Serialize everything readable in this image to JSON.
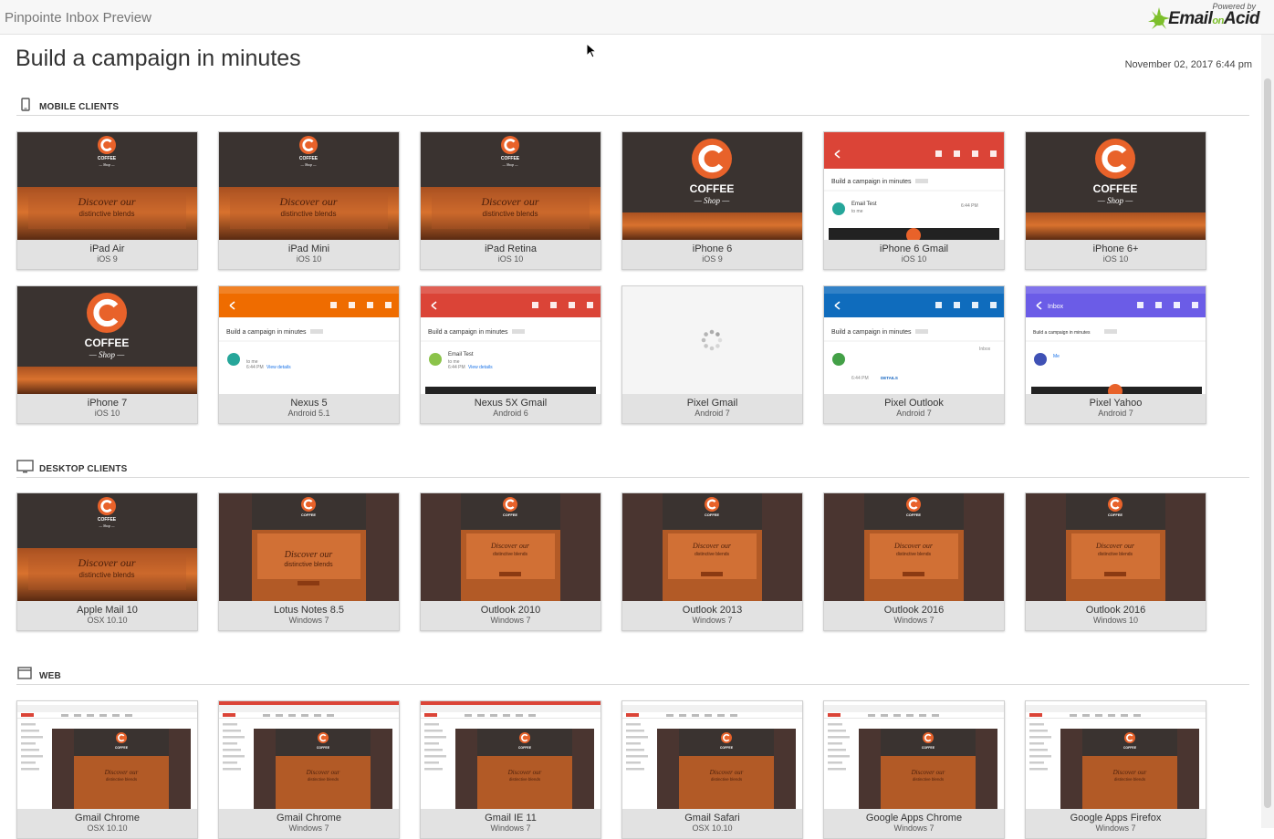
{
  "app": {
    "title": "Pinpointe Inbox Preview",
    "logo_powered": "Powered by",
    "logo_email": "Email",
    "logo_on": "on",
    "logo_acid": "Acid"
  },
  "page": {
    "title": "Build a campaign in minutes",
    "timestamp": "November 02, 2017 6:44 pm"
  },
  "sections": {
    "mobile": {
      "label": "MOBILE CLIENTS",
      "icon": "phone-icon",
      "cards": [
        {
          "name": "iPad Air",
          "os": "iOS 9",
          "kind": "coffee-hero"
        },
        {
          "name": "iPad Mini",
          "os": "iOS 10",
          "kind": "coffee-hero"
        },
        {
          "name": "iPad Retina",
          "os": "iOS 10",
          "kind": "coffee-hero"
        },
        {
          "name": "iPhone 6",
          "os": "iOS 9",
          "kind": "coffee-logo"
        },
        {
          "name": "iPhone 6 Gmail",
          "os": "iOS 10",
          "kind": "gmail-app"
        },
        {
          "name": "iPhone 6+",
          "os": "iOS 10",
          "kind": "coffee-logo"
        },
        {
          "name": "iPhone 7",
          "os": "iOS 10",
          "kind": "coffee-logo"
        },
        {
          "name": "Nexus 5",
          "os": "Android 5.1",
          "kind": "android-orange"
        },
        {
          "name": "Nexus 5X Gmail",
          "os": "Android 6",
          "kind": "android-red"
        },
        {
          "name": "Pixel Gmail",
          "os": "Android 7",
          "kind": "loading"
        },
        {
          "name": "Pixel Outlook",
          "os": "Android 7",
          "kind": "android-blue"
        },
        {
          "name": "Pixel Yahoo",
          "os": "Android 7",
          "kind": "android-purple"
        }
      ]
    },
    "desktop": {
      "label": "DESKTOP CLIENTS",
      "icon": "monitor-icon",
      "cards": [
        {
          "name": "Apple Mail 10",
          "os": "OSX 10.10",
          "kind": "coffee-hero"
        },
        {
          "name": "Lotus Notes 8.5",
          "os": "Windows 7",
          "kind": "desktop-wide"
        },
        {
          "name": "Outlook 2010",
          "os": "Windows 7",
          "kind": "desktop-narrow"
        },
        {
          "name": "Outlook 2013",
          "os": "Windows 7",
          "kind": "desktop-narrow"
        },
        {
          "name": "Outlook 2016",
          "os": "Windows 7",
          "kind": "desktop-narrow"
        },
        {
          "name": "Outlook 2016",
          "os": "Windows 10",
          "kind": "desktop-narrow"
        }
      ]
    },
    "web": {
      "label": "WEB",
      "icon": "browser-window-icon",
      "cards": [
        {
          "name": "Gmail Chrome",
          "os": "OSX 10.10",
          "kind": "web"
        },
        {
          "name": "Gmail Chrome",
          "os": "Windows 7",
          "kind": "web-red"
        },
        {
          "name": "Gmail IE 11",
          "os": "Windows 7",
          "kind": "web-red"
        },
        {
          "name": "Gmail Safari",
          "os": "OSX 10.10",
          "kind": "web"
        },
        {
          "name": "Google Apps Chrome",
          "os": "Windows 7",
          "kind": "web"
        },
        {
          "name": "Google Apps Firefox",
          "os": "Windows 7",
          "kind": "web"
        }
      ]
    }
  },
  "thumb_text": {
    "coffee": "COFFEE",
    "shop": "— Shop —",
    "discover": "Discover our",
    "blends": "distinctive blends",
    "subject": "Build a campaign in minutes",
    "sender": "Email Test",
    "to_me": "to me",
    "time": "6:44 PM",
    "inbox": "Inbox",
    "me": "Me",
    "details": "DETAILS",
    "view_details": "View details"
  },
  "colors": {
    "gmail_red": "#db4437",
    "android_orange": "#ef6c00",
    "outlook_blue": "#0f6cbd",
    "yahoo_purple": "#6b5ce7",
    "coffee_orange": "#e8622a",
    "coffee_dark": "#3a3330"
  }
}
